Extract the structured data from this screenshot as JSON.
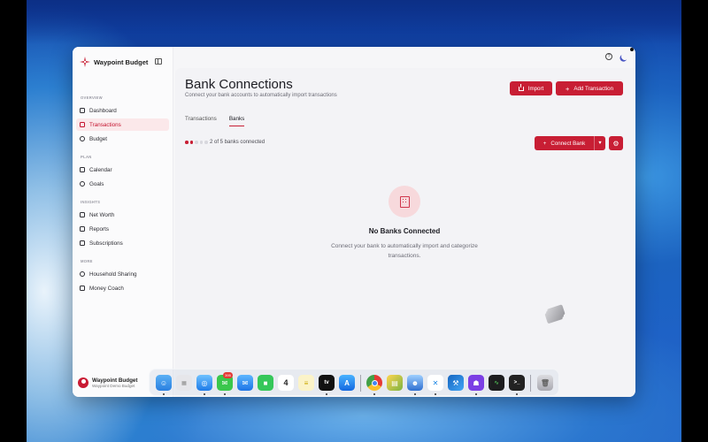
{
  "app": {
    "brand_name": "Waypoint Budget",
    "accent_color": "#c81e34"
  },
  "sidebar": {
    "sections": {
      "overview": "OVERVIEW",
      "plan": "PLAN",
      "insights": "INSIGHTS",
      "more": "MORE"
    },
    "items": [
      {
        "label": "Dashboard",
        "icon": "home-icon"
      },
      {
        "label": "Transactions",
        "icon": "receipt-icon",
        "active": true
      },
      {
        "label": "Budget",
        "icon": "pie-chart-icon"
      },
      {
        "label": "Calendar",
        "icon": "calendar-icon"
      },
      {
        "label": "Goals",
        "icon": "target-icon"
      },
      {
        "label": "Net Worth",
        "icon": "trending-up-icon"
      },
      {
        "label": "Reports",
        "icon": "chart-icon"
      },
      {
        "label": "Subscriptions",
        "icon": "credit-card-icon"
      },
      {
        "label": "Household Sharing",
        "icon": "users-icon"
      },
      {
        "label": "Money Coach",
        "icon": "coach-icon"
      }
    ],
    "user": {
      "name": "Waypoint Budget",
      "subtitle": "Waypoint Demo Budget"
    }
  },
  "header": {
    "title": "Bank Connections",
    "subtitle": "Connect your bank accounts to automatically import transactions",
    "import_label": "Import",
    "add_transaction_label": "Add Transaction"
  },
  "tabs": [
    {
      "label": "Transactions",
      "active": false
    },
    {
      "label": "Banks",
      "active": true
    }
  ],
  "banks": {
    "connected": 2,
    "total": 5,
    "status_text": "2 of 5 banks connected",
    "connect_label": "Connect Bank"
  },
  "empty_state": {
    "title": "No Banks Connected",
    "message": "Connect your bank to automatically import and categorize transactions."
  },
  "dock": {
    "messages_badge": "395",
    "calendar_day": "4",
    "tv_label": "tv"
  }
}
